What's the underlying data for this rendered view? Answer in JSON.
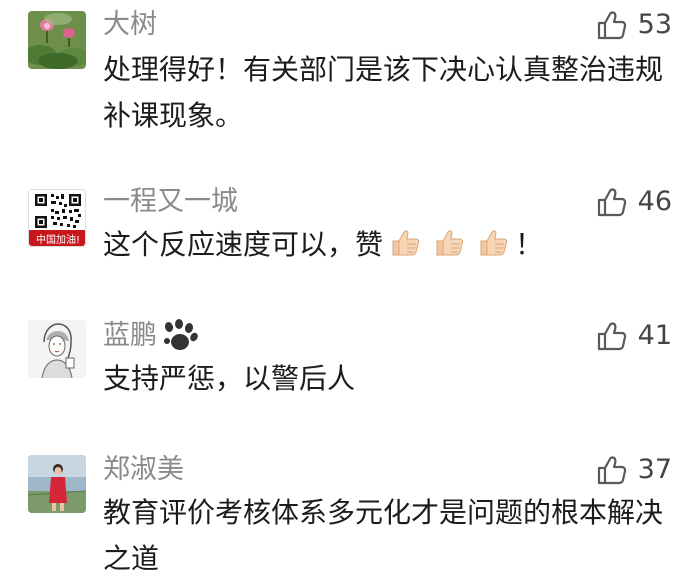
{
  "comments": [
    {
      "name": "大树",
      "text": "处理得好！有关部门是该下决心认真整治违规补课现象。",
      "likes": "53",
      "avatar_icon": "lotus-flower-photo"
    },
    {
      "name": "一程又一城",
      "text_before": "这个反应速度可以，赞",
      "text_after": "！",
      "emoji": "thumbs-up-emoji",
      "emoji_count": 3,
      "likes": "46",
      "avatar_icon": "qr-code-avatar",
      "avatar_caption": "中国加油!"
    },
    {
      "name": "蓝鹏",
      "name_badge": "paw-print-icon",
      "text": "支持严惩，以警后人",
      "likes": "41",
      "avatar_icon": "sketch-portrait-avatar"
    },
    {
      "name": "郑淑美",
      "text": "教育评价考核体系多元化才是问题的根本解决之道",
      "likes": "37",
      "avatar_icon": "person-in-red-photo"
    }
  ],
  "colors": {
    "name": "#8a8a8a",
    "text": "#1c1c1c",
    "like_icon": "#5a5a5a"
  }
}
